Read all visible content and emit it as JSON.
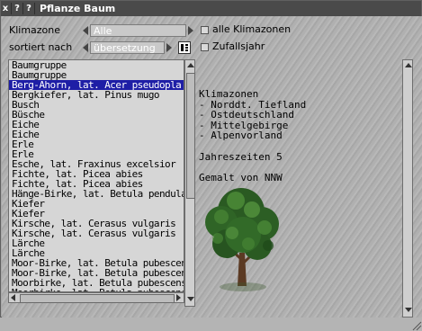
{
  "window": {
    "title": "Pflanze Baum",
    "buttons": [
      "x",
      "?",
      "?"
    ]
  },
  "filters": {
    "klimazone_label": "Klimazone",
    "klimazone_value": "Alle",
    "alle_klimazonen_label": "alle Klimazonen",
    "sortiert_label": "sortiert nach",
    "sortiert_value": "übersetzung",
    "zufallsjahr_label": "Zufallsjahr"
  },
  "list": {
    "items": [
      "Baumgruppe",
      "Baumgruppe",
      "Berg-Ahorn, lat. Acer pseudopla",
      "Bergkiefer, lat. Pinus mugo",
      "Busch",
      "Büsche",
      "Eiche",
      "Eiche",
      "Erle",
      "Erle",
      "Esche, lat. Fraxinus excelsior",
      "Fichte, lat. Picea abies",
      "Fichte, lat. Picea abies",
      "Hänge-Birke, lat. Betula pendula",
      "Kiefer",
      "Kiefer",
      "Kirsche, lat. Cerasus vulgaris",
      "Kirsche, lat. Cerasus vulgaris",
      "Lärche",
      "Lärche",
      "Moor-Birke, lat. Betula pubescen",
      "Moor-Birke, lat. Betula pubescen",
      "Moorbirke, lat. Betula pubescens",
      "Moorbirke, lat. Betula pubescens"
    ],
    "selected_index": 2
  },
  "info": {
    "klimazonen_title": "Klimazonen",
    "zones": [
      "- Norddt. Tiefland",
      "- Ostdeutschland",
      "- Mittelgebirge",
      "- Alpenvorland"
    ],
    "jahreszeiten": "Jahreszeiten 5",
    "gemalt": "Gemalt von NNW"
  },
  "colors": {
    "selection": "#1e1ea6",
    "titlebar": "#4a4a4a",
    "tree_dark": "#1f4a1a",
    "tree_light": "#4f8f3a",
    "trunk": "#5b3a23"
  }
}
